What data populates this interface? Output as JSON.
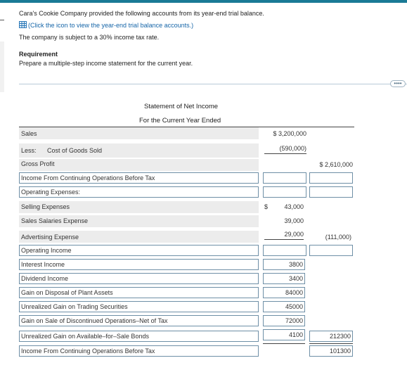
{
  "intro": {
    "line1": "Cara's Cookie Company provided the following accounts from its year-end trial balance.",
    "link": "(Click the icon to view the year-end trial balance accounts.)",
    "line3": "The company is subject to a 30% income tax rate."
  },
  "requirement": {
    "heading": "Requirement",
    "text": "Prepare a multiple-step income statement for the current year."
  },
  "more_button": "••••",
  "statement": {
    "title": "Statement of Net Income",
    "subtitle": "For the Current Year Ended",
    "sales_label": "Sales",
    "sales_value": "$ 3,200,000",
    "less_label": "Less:",
    "cogs_label": "Cost of Goods Sold",
    "cogs_value": "(590,000)",
    "gross_profit_label": "Gross Profit",
    "gross_profit_value": "$ 2,610,000",
    "row_continuing_1": "Income From Continuing Operations Before Tax",
    "row_opex": "Operating Expenses:",
    "selling_label": "Selling Expenses",
    "selling_dollar": "$",
    "selling_value": "43,000",
    "salaries_label": "Sales Salaries Expense",
    "salaries_value": "39,000",
    "advertising_label": "Advertising Expense",
    "advertising_value": "29,000",
    "opex_total": "(111,000)",
    "row_operating_income": "Operating Income",
    "interest_label": "Interest Income",
    "interest_value": "3800",
    "dividend_label": "Dividend Income",
    "dividend_value": "3400",
    "gain_plant_label": "Gain on Disposal of Plant Assets",
    "gain_plant_value": "84000",
    "unrealized_trading_label": "Unrealized Gain on Trading Securities",
    "unrealized_trading_value": "45000",
    "discontinued_label": "Gain on Sale of Discontinued Operations–Net of Tax",
    "discontinued_value": "72000",
    "afs_label": "Unrealized Gain on Available–for–Sale Bonds",
    "afs_value": "4100",
    "other_total": "212300",
    "continuing_final_label": "Income From Continuing Operations Before Tax",
    "continuing_final_value": "101300"
  }
}
